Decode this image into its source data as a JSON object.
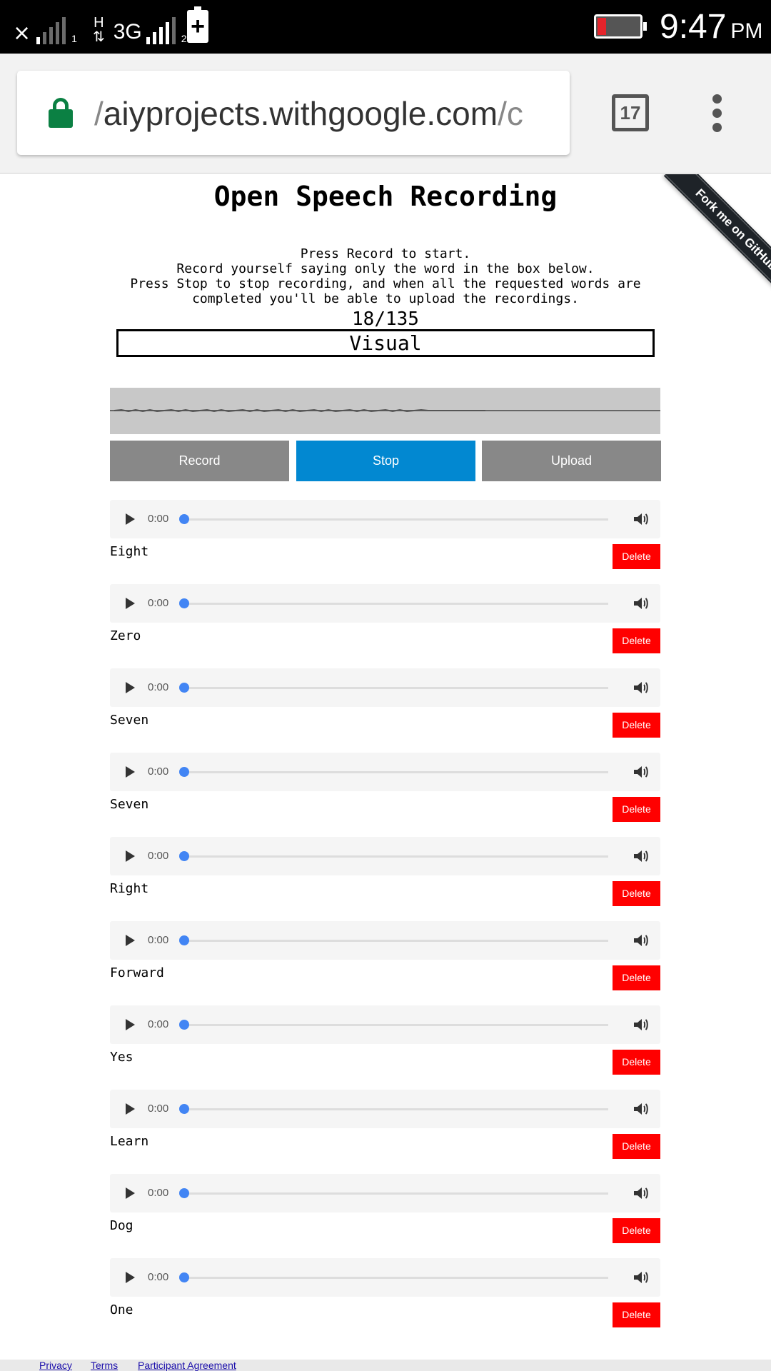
{
  "status_bar": {
    "sim1_x": "×",
    "sim1_sub": "1",
    "net_h": "H",
    "net_arrows": "⇅",
    "net_3g": "3G",
    "sim2_sub": "2",
    "charge_symbol": "+",
    "time": "9:47",
    "ampm": "PM",
    "icons": [
      "signal-icon",
      "signal-icon",
      "battery-charging-icon",
      "battery-icon"
    ]
  },
  "browser": {
    "url_prefix": "/",
    "url_host": "aiyprojects.withgoogle.com",
    "url_suffix": "/c",
    "tab_count": "17",
    "lock_color": "#0b8043"
  },
  "page": {
    "title": "Open Speech Recording",
    "ribbon": "Fork me on GitHub",
    "instructions": [
      "Press Record to start.",
      "Record yourself saying only the word in the box below.",
      "Press Stop to stop recording, and when all the requested words are",
      "completed you'll be able to upload the recordings."
    ],
    "counter": "18/135",
    "current_word": "Visual",
    "buttons": {
      "record": "Record",
      "stop": "Stop",
      "upload": "Upload"
    },
    "colors": {
      "stop": "#0288d1",
      "inactive": "#888888",
      "delete": "#ff0000"
    },
    "clip_time": "0:00",
    "delete_label": "Delete",
    "clips": [
      {
        "label": "Eight"
      },
      {
        "label": "Zero"
      },
      {
        "label": "Seven"
      },
      {
        "label": "Seven"
      },
      {
        "label": "Right"
      },
      {
        "label": "Forward"
      },
      {
        "label": "Yes"
      },
      {
        "label": "Learn"
      },
      {
        "label": "Dog"
      },
      {
        "label": "One"
      }
    ]
  },
  "footer": {
    "privacy": "Privacy",
    "terms": "Terms",
    "agreement": "Participant Agreement"
  }
}
